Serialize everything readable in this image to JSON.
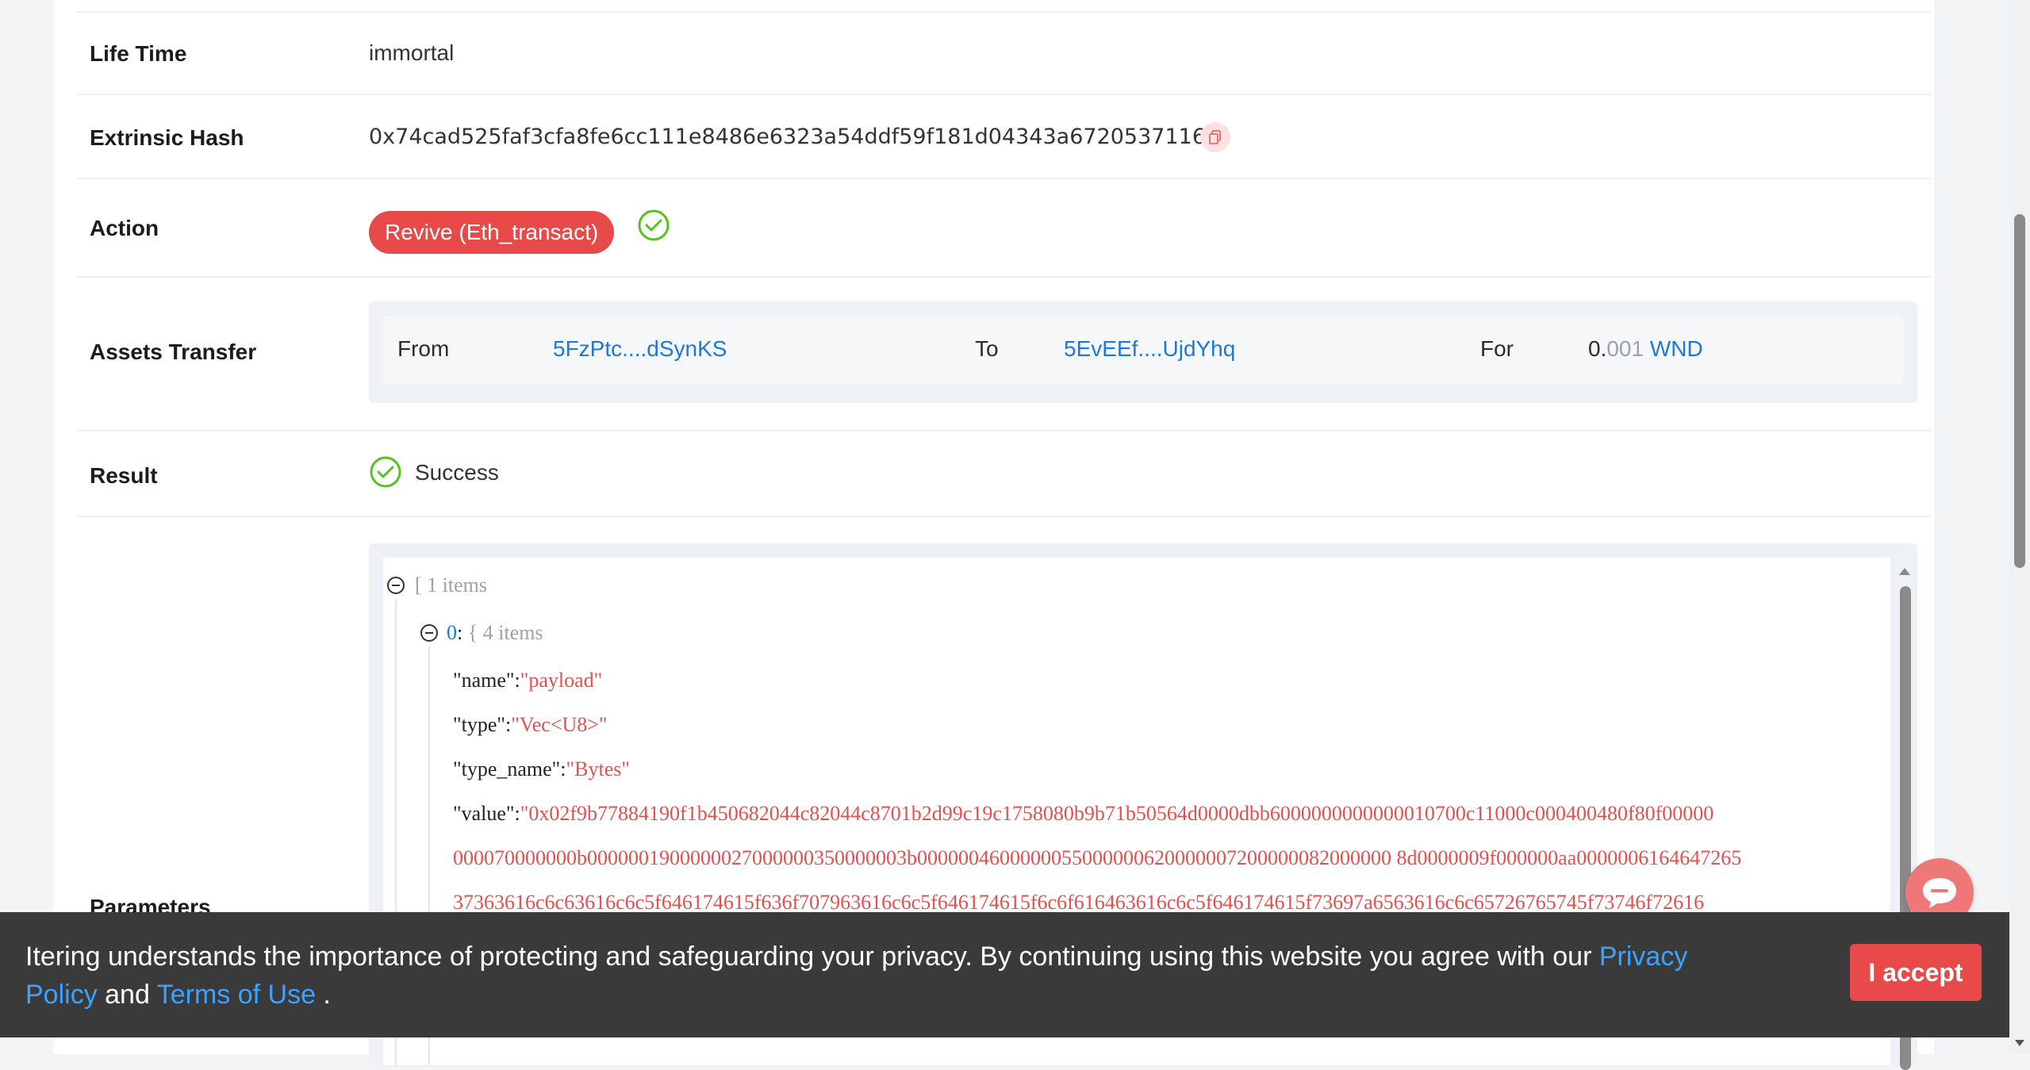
{
  "details": {
    "life_time": {
      "label": "Life Time",
      "value": "immortal"
    },
    "extrinsic_hash": {
      "label": "Extrinsic Hash",
      "value": "0x74cad525faf3cfa8fe6cc111e8486e6323a54ddf59f181d04343a67205371164"
    },
    "action": {
      "label": "Action",
      "value": "Revive (Eth_transact)"
    },
    "assets_transfer": {
      "label": "Assets Transfer",
      "from_label": "From",
      "from_value": "5FzPtc....dSynKS",
      "to_label": "To",
      "to_value": "5EvEEf....UjdYhq",
      "for_label": "For",
      "amount_int": "0.",
      "amount_dec": "001",
      "token": "WND"
    },
    "result": {
      "label": "Result",
      "value": "Success"
    },
    "parameters": {
      "label": "Parameters"
    }
  },
  "json_view": {
    "root_open": "[",
    "root_count": "1 items",
    "item_index": "0",
    "item_colon": ":",
    "item_open": "{",
    "item_count": "4 items",
    "fields": [
      {
        "key": "\"name\"",
        "colon": ":",
        "value": "\"payload\""
      },
      {
        "key": "\"type\"",
        "colon": ":",
        "value": "\"Vec<U8>\""
      },
      {
        "key": "\"type_name\"",
        "colon": ":",
        "value": "\"Bytes\""
      },
      {
        "key": "\"value\"",
        "colon": ":",
        "value": "\"0x02f9b77884190f1b450682044c82044c8701b2d99c19c1758080b9b71b50564d0000dbb6000000000000010700c11000c000400480f80f00000"
      }
    ],
    "value_cont_1": "000070000000b0000001900000027000000350000003b0000004600000055000000620000007200000082000000 8d0000009f000000aa0000006164647265",
    "value_cont_2": "37363616c6c63616c6c5f646174615f636f707963616c6c5f646174615f6c6f616463616c6c5f646174615f73697a6563616c6c65726765745f73746f72616"
  },
  "cookie": {
    "text_before": "Itering understands the importance of protecting and safeguarding your privacy. By continuing using this website you agree with our ",
    "privacy_link": "Privacy Policy",
    "and_text": " and ",
    "terms_link": "Terms of Use",
    "end_text": " .",
    "accept_label": "I accept"
  },
  "colors": {
    "accent": "#e84a4a",
    "link": "#1c79d6",
    "success": "#52c41a"
  }
}
